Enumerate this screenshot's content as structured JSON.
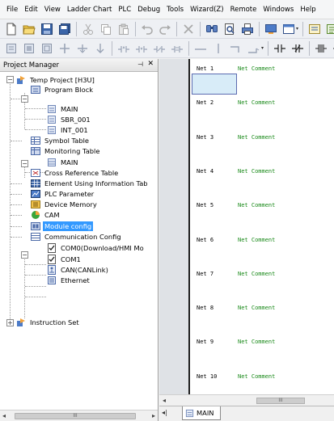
{
  "menu": [
    "File",
    "Edit",
    "View",
    "Ladder Chart",
    "PLC",
    "Debug",
    "Tools",
    "Wizard(Z)",
    "Remote",
    "Windows",
    "Help"
  ],
  "project_manager": {
    "title": "Project Manager",
    "pin_glyph": "4",
    "close_glyph": "✕",
    "tree": {
      "root": "Temp Project [H3U]",
      "program_block": "Program Block",
      "main": "MAIN",
      "sbr": "SBR_001",
      "int": "INT_001",
      "symbol_table": "Symbol Table",
      "monitoring_table": "Monitoring Table",
      "mon_main": "MAIN",
      "cross_ref": "Cross Reference Table",
      "element_info": "Element Using Information Tab",
      "plc_param": "PLC Parameter",
      "device_memory": "Device Memory",
      "cam": "CAM",
      "module_config": "Module config",
      "comm_config": "Communication Config",
      "com0": "COM0(Download/HMI Mo",
      "com1": "COM1",
      "can": "CAN(CANLink)",
      "ethernet": "Ethernet",
      "instruction_set": "Instruction Set"
    }
  },
  "editor": {
    "nets": [
      {
        "num": "Net 1",
        "comment": "Net Comment"
      },
      {
        "num": "Net 2",
        "comment": "Net Comment"
      },
      {
        "num": "Net 3",
        "comment": "Net Comment"
      },
      {
        "num": "Net 4",
        "comment": "Net Comment"
      },
      {
        "num": "Net 5",
        "comment": "Net Comment"
      },
      {
        "num": "Net 6",
        "comment": "Net Comment"
      },
      {
        "num": "Net 7",
        "comment": "Net Comment"
      },
      {
        "num": "Net 8",
        "comment": "Net Comment"
      },
      {
        "num": "Net 9",
        "comment": "Net Comment"
      },
      {
        "num": "Net 10",
        "comment": "Net Comment"
      }
    ],
    "tab": "MAIN",
    "scroll_thumb_glyph": "III"
  },
  "icons": {
    "toolbar1": [
      "new-file-icon",
      "open-folder-icon",
      "save-icon",
      "save-all-icon",
      "cut-icon",
      "copy-icon",
      "paste-icon",
      "undo-icon",
      "redo-icon",
      "delete-icon",
      "find-icon",
      "print-preview-icon",
      "print-icon",
      "monitor-icon",
      "window-mode-icon",
      "ladder-view-icon",
      "list-view-icon"
    ],
    "toolbar2": [
      "block-a-icon",
      "block-b-icon",
      "block-c-icon",
      "plus-icon",
      "down-arrow-icon",
      "down-arrow-2-icon",
      "contact-up-icon",
      "contact-dn-icon",
      "contact-ne-icon",
      "contact-eq-icon",
      "hline-icon",
      "vline-icon",
      "branch-icon",
      "branch-end-icon",
      "no-contact-icon",
      "nc-contact-icon",
      "pulse-contact-icon",
      "fall-contact-icon"
    ]
  },
  "colors": {
    "selection": "#3399ff",
    "comment": "#1a8a1a",
    "rail": "#1f1f1f"
  }
}
